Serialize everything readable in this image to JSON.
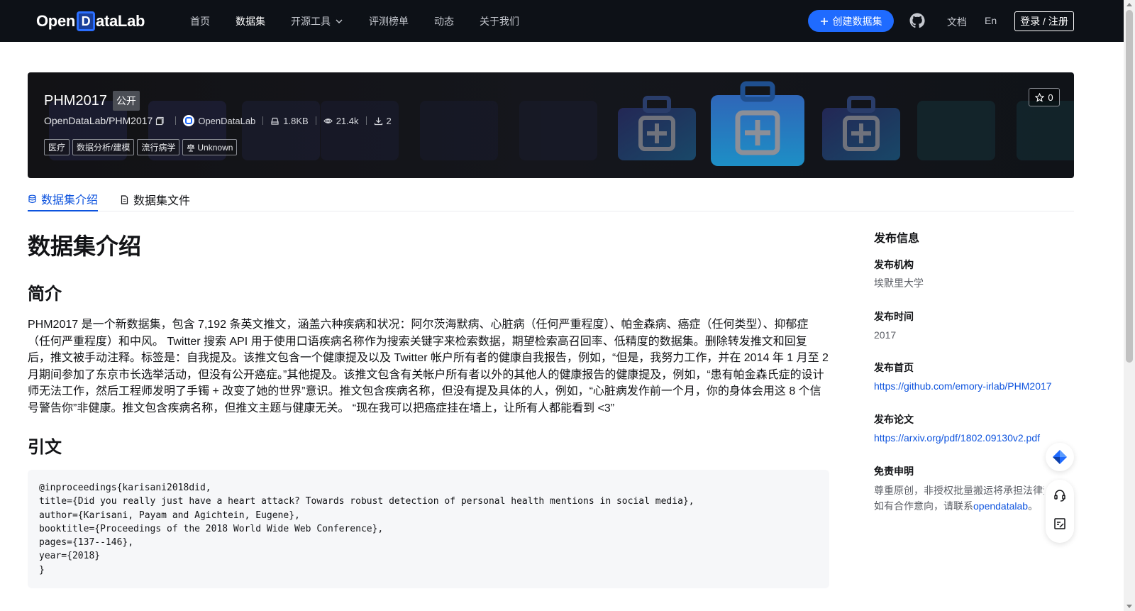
{
  "nav": {
    "logo_pre": "Open",
    "logo_d": "D",
    "logo_post": "ataLab",
    "items": [
      {
        "label": "首页"
      },
      {
        "label": "数据集"
      },
      {
        "label": "开源工具"
      },
      {
        "label": "评测榜单"
      },
      {
        "label": "动态"
      },
      {
        "label": "关于我们"
      }
    ],
    "create_button": "创建数据集",
    "docs": "文档",
    "lang": "En",
    "login": "登录 / 注册"
  },
  "dataset": {
    "name": "PHM2017",
    "visibility": "公开",
    "path": "OpenDataLab/PHM2017",
    "publisher": "OpenDataLab",
    "size": "1.8KB",
    "views": "21.4k",
    "downloads": "2",
    "stars": "0",
    "tags": [
      "医疗",
      "数据分析/建模",
      "流行病学"
    ],
    "license": "Unknown"
  },
  "tabs": {
    "intro": "数据集介绍",
    "files": "数据集文件"
  },
  "content": {
    "heading": "数据集介绍",
    "summary_heading": "简介",
    "summary": "PHM2017 是一个新数据集，包含 7,192 条英文推文，涵盖六种疾病和状况：阿尔茨海默病、心脏病（任何严重程度）、帕金森病、癌症（任何类型）、抑郁症（任何严重程度）和中风。 Twitter 搜索 API 用于使用口语疾病名称作为搜索关键字来检索数据，期望检索高召回率、低精度的数据集。删除转发推文和回复后，推文被手动注释。标签是：自我提及。该推文包含一个健康提及以及 Twitter 帐户所有者的健康自我报告，例如，“但是，我努力工作，并在 2014 年 1 月至 2 月期间参加了东京市长选举活动，但没有公开癌症。”其他提及。该推文包含有关帐户所有者以外的其他人的健康报告的健康提及，例如，“患有帕金森氏症的设计师无法工作，然后工程师发明了手镯 + 改变了她的世界”意识。推文包含疾病名称，但没有提及具体的人，例如，“心脏病发作前一个月，你的身体会用这 8 个信号警告你”非健康。推文包含疾病名称，但推文主题与健康无关。 “现在我可以把癌症挂在墙上，让所有人都能看到 <3”",
    "citation_heading": "引文",
    "citation": "@inproceedings{karisani2018did,\ntitle={Did you really just have a heart attack? Towards robust detection of personal health mentions in social media},\nauthor={Karisani, Payam and Agichtein, Eugene},\nbooktitle={Proceedings of the 2018 World Wide Web Conference},\npages={137--146},\nyear={2018}\n}"
  },
  "sidebar": {
    "title": "发布信息",
    "org_label": "发布机构",
    "org_value": "埃默里大学",
    "time_label": "发布时间",
    "time_value": "2017",
    "home_label": "发布首页",
    "home_value": "https://github.com/emory-irlab/PHM2017",
    "paper_label": "发布论文",
    "paper_value": "https://arxiv.org/pdf/1802.09130v2.pdf",
    "disclaimer_label": "免责申明",
    "disclaimer_line1": "尊重原创，非授权批量搬运将承担法律责",
    "disclaimer_line2_pre": "如有合作意向，请联系",
    "disclaimer_link": "opendatalab",
    "disclaimer_line2_post": "。"
  },
  "colors": {
    "nav_bg": "#0d1117",
    "accent": "#1f6bff",
    "link": "#0d53de"
  }
}
